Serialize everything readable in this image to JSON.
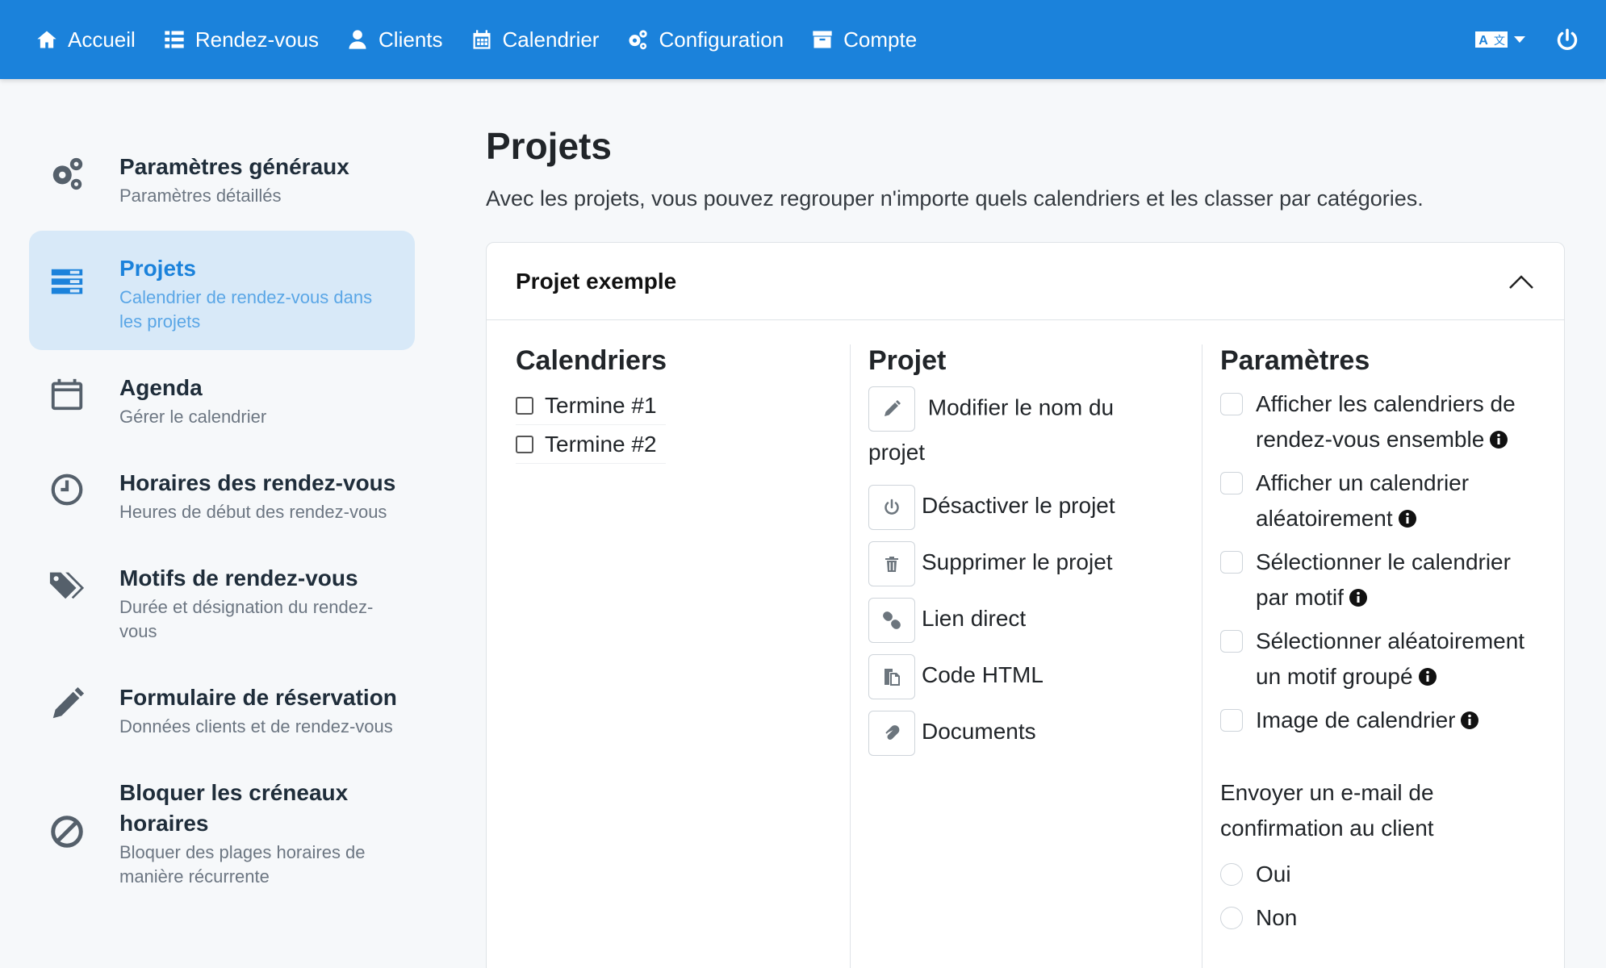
{
  "navbar": {
    "items": [
      {
        "label": "Accueil",
        "icon": "home-icon"
      },
      {
        "label": "Rendez-vous",
        "icon": "list-icon"
      },
      {
        "label": "Clients",
        "icon": "user-icon"
      },
      {
        "label": "Calendrier",
        "icon": "calendar-icon"
      },
      {
        "label": "Configuration",
        "icon": "cogs-icon"
      },
      {
        "label": "Compte",
        "icon": "archive-icon"
      }
    ],
    "right_icons": [
      "language-icon",
      "power-icon"
    ],
    "color": "#1b82db"
  },
  "sidebar": {
    "items": [
      {
        "title": "Paramètres généraux",
        "subtitle": "Paramètres détaillés",
        "icon": "cogs-icon"
      },
      {
        "title": "Projets",
        "subtitle": "Calendrier de rendez-vous dans les projets",
        "icon": "stacked-bars-icon",
        "active": true
      },
      {
        "title": "Agenda",
        "subtitle": "Gérer le calendrier",
        "icon": "calendar-icon"
      },
      {
        "title": "Horaires des rendez-vous",
        "subtitle": "Heures de début des rendez-vous",
        "icon": "clock-icon"
      },
      {
        "title": "Motifs de rendez-vous",
        "subtitle": "Durée et désignation du rendez-vous",
        "icon": "tags-icon"
      },
      {
        "title": "Formulaire de réservation",
        "subtitle": "Données clients et de rendez-vous",
        "icon": "pencil-icon"
      },
      {
        "title": "Bloquer les créneaux horaires",
        "subtitle": "Bloquer des plages horaires de manière récurrente",
        "icon": "ban-icon"
      }
    ]
  },
  "main": {
    "title": "Projets",
    "description": "Avec les projets, vous pouvez regrouper n'importe quels calendriers et les classer par catégories."
  },
  "project": {
    "name": "Projet exemple",
    "calendars_title": "Calendriers",
    "calendars": [
      "Termine #1",
      "Termine #2"
    ],
    "project_title": "Projet",
    "actions": [
      {
        "label": "Modifier le nom du projet",
        "icon": "pencil-icon"
      },
      {
        "label": "Désactiver le projet",
        "icon": "power-icon"
      },
      {
        "label": "Supprimer le projet",
        "icon": "trash-icon"
      },
      {
        "label": "Lien direct",
        "icon": "link-icon"
      },
      {
        "label": "Code HTML",
        "icon": "copy-icon"
      },
      {
        "label": "Documents",
        "icon": "paperclip-icon"
      }
    ],
    "settings_title": "Paramètres",
    "settings": [
      "Afficher les calendriers de rendez-vous ensemble",
      "Afficher un calendrier aléatoirement",
      "Sélectionner le calendrier par motif",
      "Sélectionner aléatoirement un motif groupé",
      "Image de calendrier"
    ],
    "email_label": "Envoyer un e-mail de confirmation au client",
    "email_options": [
      "Oui",
      "Non"
    ]
  }
}
